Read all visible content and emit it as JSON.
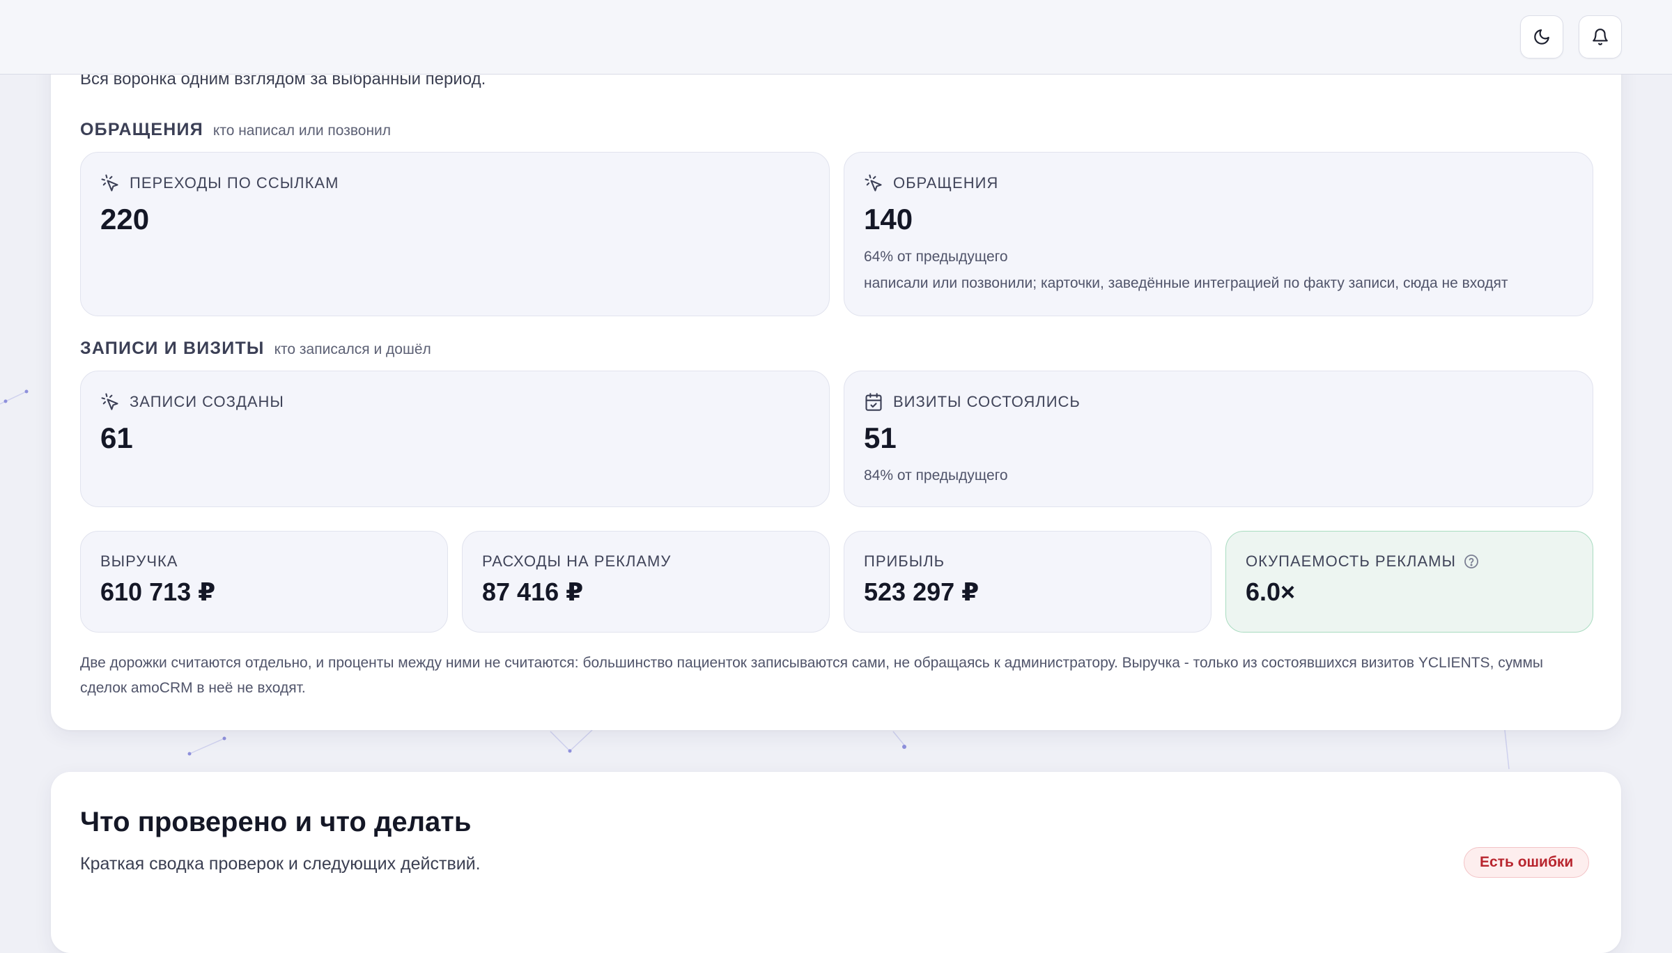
{
  "header": {
    "theme_icon": "moon-icon",
    "notifications_icon": "bell-icon"
  },
  "funnel": {
    "subtitle": "Вся воронка одним взглядом за выбранный период.",
    "inquiries_section": {
      "title": "ОБРАЩЕНИЯ",
      "hint": "кто написал или позвонил",
      "cards": [
        {
          "label": "ПЕРЕХОДЫ ПО ССЫЛКАМ",
          "value": "220",
          "icon": "cursor-click-icon"
        },
        {
          "label": "ОБРАЩЕНИЯ",
          "value": "140",
          "icon": "cursor-click-icon",
          "ratio": "64% от предыдущего",
          "note": "написали или позвонили; карточки, заведённые интеграцией по факту записи, сюда не входят"
        }
      ]
    },
    "bookings_section": {
      "title": "ЗАПИСИ И ВИЗИТЫ",
      "hint": "кто записался и дошёл",
      "cards": [
        {
          "label": "ЗАПИСИ СОЗДАНЫ",
          "value": "61",
          "icon": "cursor-click-icon"
        },
        {
          "label": "ВИЗИТЫ СОСТОЯЛИСЬ",
          "value": "51",
          "icon": "calendar-check-icon",
          "ratio": "84% от предыдущего"
        }
      ]
    },
    "finance": [
      {
        "label": "ВЫРУЧКА",
        "value": "610 713 ₽"
      },
      {
        "label": "РАСХОДЫ НА РЕКЛАМУ",
        "value": "87 416 ₽"
      },
      {
        "label": "ПРИБЫЛЬ",
        "value": "523 297 ₽"
      },
      {
        "label": "ОКУПАЕМОСТЬ РЕКЛАМЫ",
        "value": "6.0×",
        "icon": "help-circle-icon",
        "accent": "#a9dcc0"
      }
    ],
    "footnote": "Две дорожки считаются отдельно, и проценты между ними не считаются: большинство пациенток записываются сами, не обращаясь к администратору. Выручка - только из состоявшихся визитов YCLIENTS, суммы сделок amoCRM в неё не входят."
  },
  "checks": {
    "title": "Что проверено и что делать",
    "subtitle": "Краткая сводка проверок и следующих действий.",
    "status_badge": "Есть ошибки",
    "status_color": "#b8252e"
  }
}
